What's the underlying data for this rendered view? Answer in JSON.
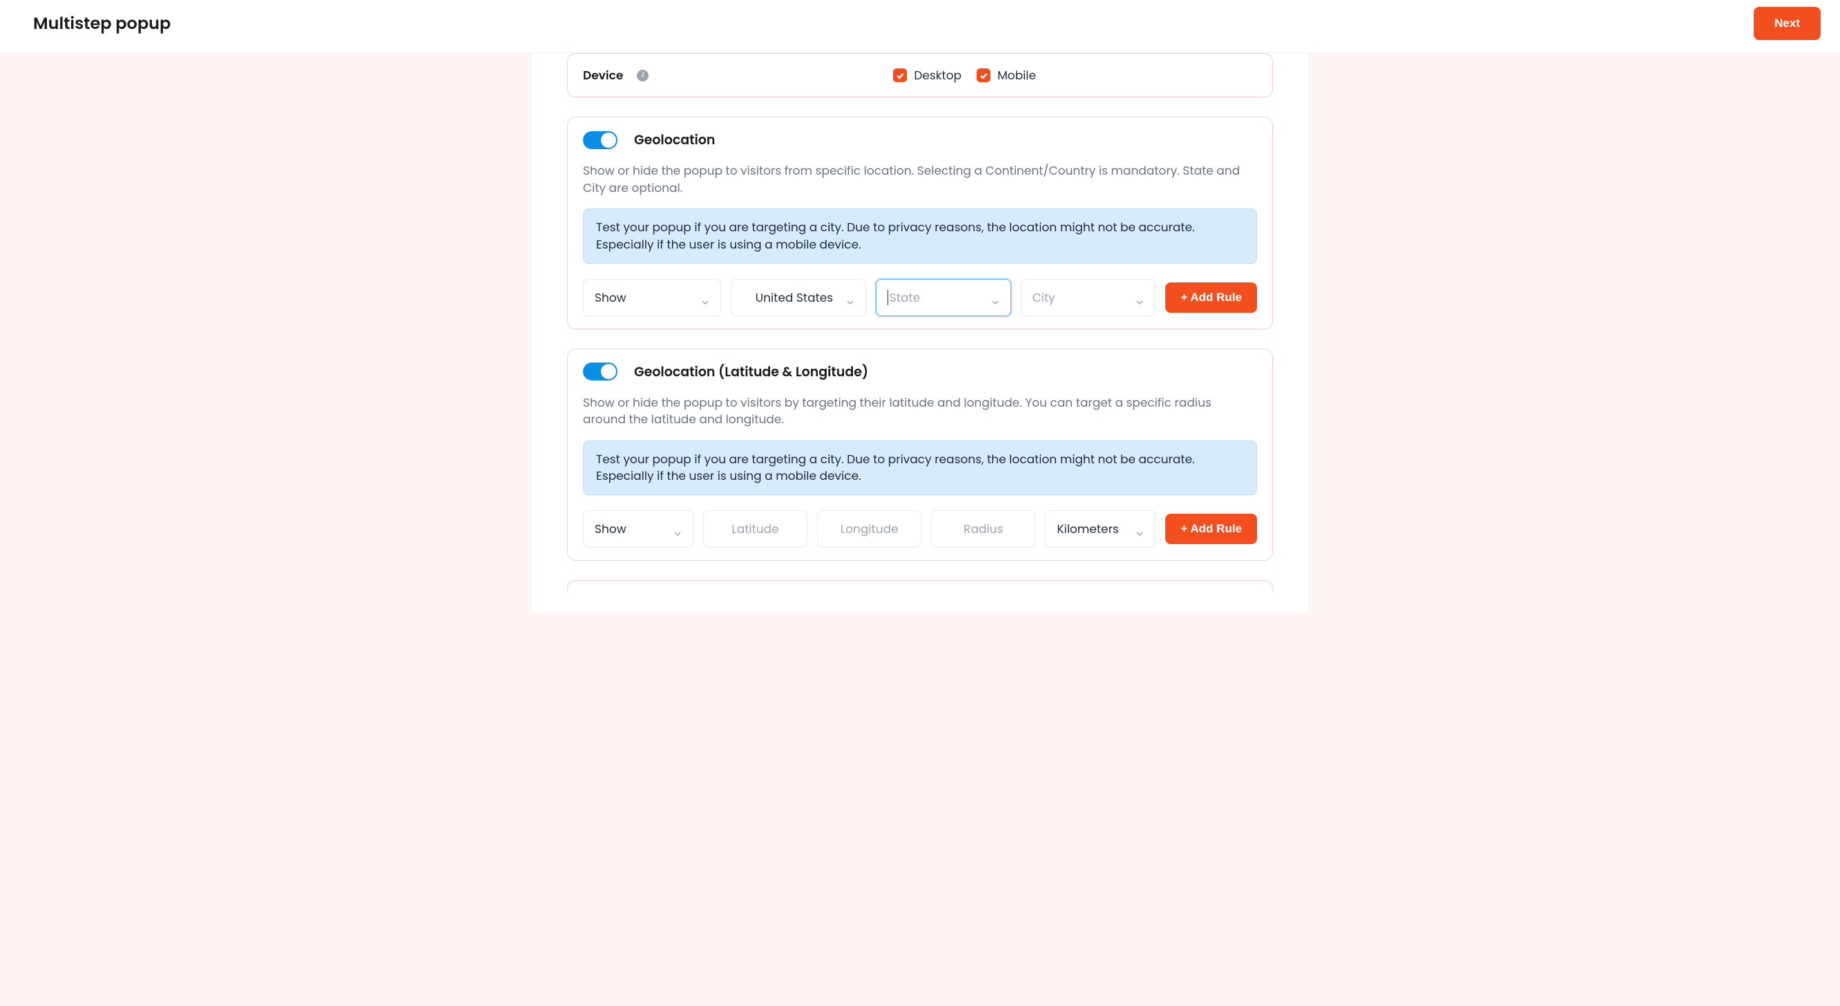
{
  "header": {
    "title": "Multistep popup",
    "next_label": "Next"
  },
  "device": {
    "label": "Device",
    "options": [
      {
        "label": "Desktop",
        "checked": true
      },
      {
        "label": "Mobile",
        "checked": true
      }
    ]
  },
  "geolocation": {
    "title": "Geolocation",
    "enabled": true,
    "description": "Show or hide the popup to visitors from specific location. Selecting a Continent/Country is mandatory. State and City are optional.",
    "note": "Test your popup if you are targeting a city. Due to privacy reasons, the location might not be accurate. Especially if the user is using a mobile device.",
    "rule": {
      "action": "Show",
      "country": "United States",
      "state_placeholder": "State",
      "city_placeholder": "City"
    },
    "add_rule_label": "+ Add Rule"
  },
  "geolocation_latlng": {
    "title": "Geolocation (Latitude & Longitude)",
    "enabled": true,
    "description": "Show or hide the popup to visitors by targeting their latitude and longitude. You can target a specific radius around the latitude and longitude.",
    "note": "Test your popup if you are targeting a city. Due to privacy reasons, the location might not be accurate. Especially if the user is using a mobile device.",
    "rule": {
      "action": "Show",
      "lat_placeholder": "Latitude",
      "lng_placeholder": "Longitude",
      "radius_placeholder": "Radius",
      "unit": "Kilometers"
    },
    "add_rule_label": "+ Add Rule"
  }
}
